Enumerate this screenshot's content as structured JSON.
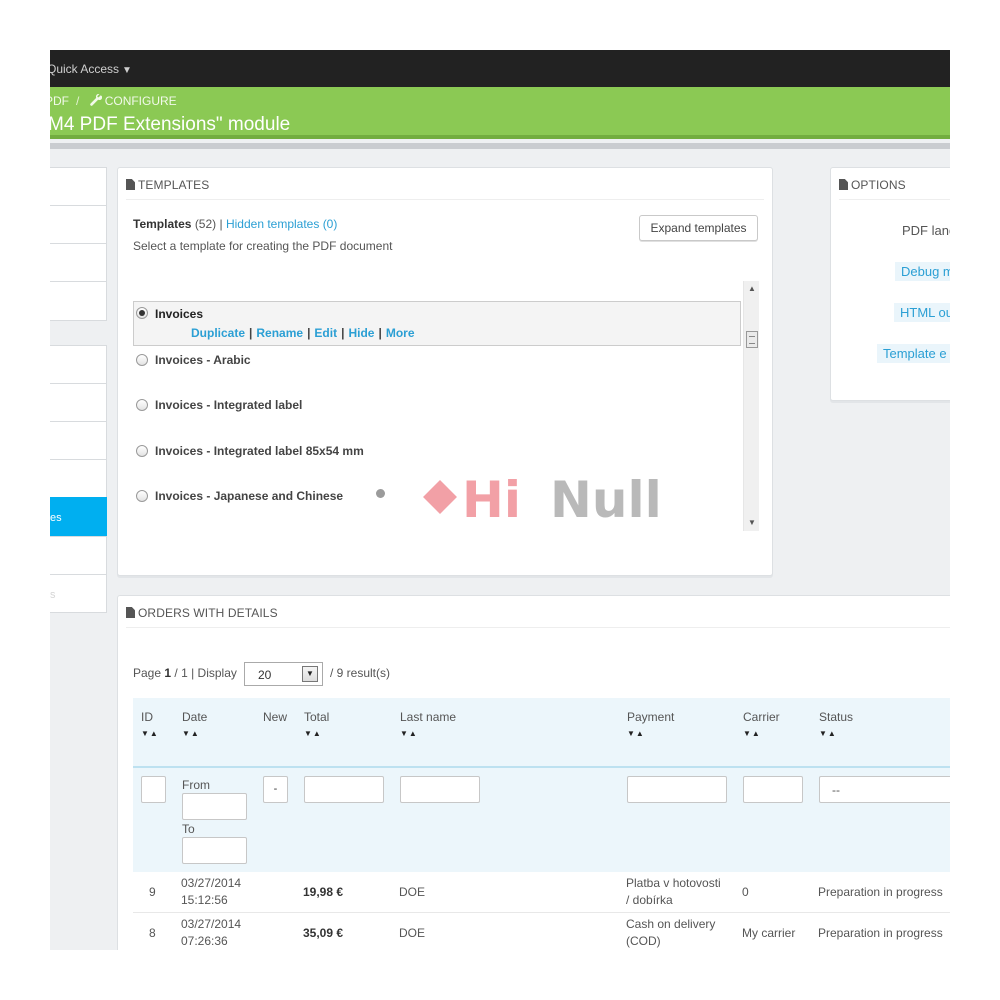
{
  "topbar": {
    "quick_access": "Quick Access"
  },
  "header": {
    "breadcrumb_parent": "PDF",
    "breadcrumb_sep": "/",
    "breadcrumb_current": "CONFIGURE",
    "title": "M4 PDF Extensions\" module"
  },
  "sidebar": {
    "active_label": "es",
    "last_label": "s"
  },
  "templates_panel": {
    "heading": "TEMPLATES",
    "count_label": "Templates",
    "count_value": "(52)",
    "separator": "|",
    "hidden_link": "Hidden templates (0)",
    "description": "Select a template for creating the PDF document",
    "expand_button": "Expand templates",
    "items": [
      {
        "name": "Invoices",
        "selected": true
      },
      {
        "name": "Invoices - Arabic",
        "selected": false
      },
      {
        "name": "Invoices - Integrated label",
        "selected": false
      },
      {
        "name": "Invoices - Integrated label 85x54 mm",
        "selected": false
      },
      {
        "name": "Invoices - Japanese and Chinese",
        "selected": false
      }
    ],
    "actions": {
      "duplicate": "Duplicate",
      "rename": "Rename",
      "edit": "Edit",
      "hide": "Hide",
      "more": "More",
      "sep": "|"
    }
  },
  "watermark": {
    "hi": "Hi",
    "null": "Null"
  },
  "options_panel": {
    "heading": "OPTIONS",
    "pdf_language": "PDF lang",
    "debug_button": "Debug m",
    "html_button": "HTML ou",
    "template_button": "Template e"
  },
  "orders_panel": {
    "heading": "ORDERS WITH DETAILS",
    "page_label": "Page",
    "page_current": "1",
    "page_total": "/ 1 | Display",
    "display_value": "20",
    "results": "/ 9 result(s)",
    "columns": {
      "id": "ID",
      "date": "Date",
      "new": "New",
      "total": "Total",
      "last_name": "Last name",
      "payment": "Payment",
      "carrier": "Carrier",
      "status": "Status"
    },
    "filters": {
      "from": "From",
      "to": "To",
      "new_value": "-",
      "status_value": "--"
    },
    "rows": [
      {
        "id": "9",
        "date": "03/27/2014",
        "time": "15:12:56",
        "total": "19,98 €",
        "last_name": "DOE",
        "payment_line1": "Platba v hotovosti",
        "payment_line2": "/ dobírka",
        "carrier": "0",
        "status": "Preparation in progress"
      },
      {
        "id": "8",
        "date": "03/27/2014",
        "time": "07:26:36",
        "total": "35,09 €",
        "last_name": "DOE",
        "payment_line1": "Cash on delivery",
        "payment_line2": "(COD)",
        "carrier": "My carrier",
        "status": "Preparation in progress"
      }
    ]
  }
}
